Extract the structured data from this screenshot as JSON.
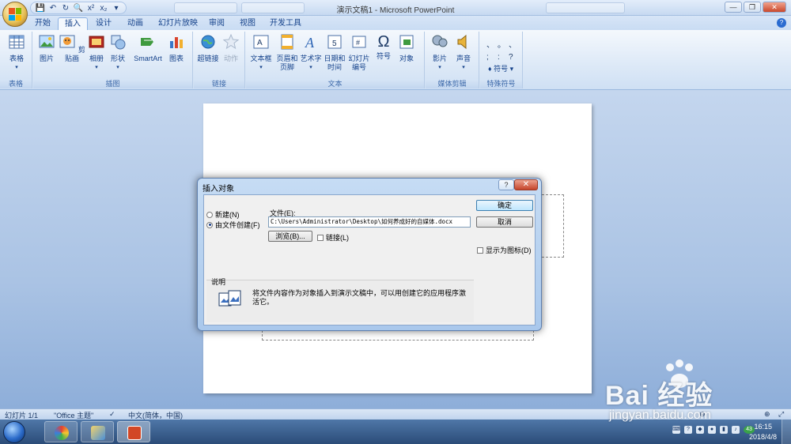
{
  "window": {
    "title": "演示文稿1 - Microsoft PowerPoint",
    "min_glyph": "—",
    "max_glyph": "❐",
    "close_glyph": "✕"
  },
  "qat": {
    "icons": [
      "save-icon",
      "undo-icon",
      "redo-icon",
      "print-preview-icon",
      "superscript-icon",
      "subscript-icon"
    ],
    "glyphs": [
      "💾",
      "↶",
      "↻",
      "🔍",
      "x²",
      "x₂"
    ],
    "more": "▾"
  },
  "tabs": [
    {
      "label": "开始"
    },
    {
      "label": "插入"
    },
    {
      "label": "设计"
    },
    {
      "label": "动画"
    },
    {
      "label": "幻灯片放映"
    },
    {
      "label": "审阅"
    },
    {
      "label": "视图"
    },
    {
      "label": "开发工具"
    }
  ],
  "active_tab": "插入",
  "ribbon": {
    "groups": {
      "table": "表格",
      "illustrations": "插图",
      "links": "链接",
      "text": "文本",
      "media": "媒体剪辑",
      "symbols": "特殊符号"
    },
    "buttons": {
      "table": "表格",
      "picture": "图片",
      "clipart": "剪贴画",
      "album": "相册",
      "shapes": "形状",
      "smartart": "SmartArt",
      "chart": "图表",
      "hyperlink": "超链接",
      "action": "动作",
      "textbox": "文本框",
      "header_footer": "页眉和页脚",
      "wordart": "艺术字",
      "datetime": "日期和时间",
      "slide_number": "幻灯片编号",
      "symbol": "符号",
      "object": "对象",
      "movie": "影片",
      "sound": "声音",
      "special_symbol": "符号"
    },
    "symbol_grid": [
      "、",
      "。",
      "、",
      ";",
      ":",
      "?"
    ],
    "omega": "Ω"
  },
  "dialog": {
    "title": "插入对象",
    "help": "?",
    "close": "✕",
    "radio_new": "新建(N)",
    "radio_from_file": "由文件创建(F)",
    "selected": "from_file",
    "file_label": "文件(E):",
    "file_value": "C:\\Users\\Administrator\\Desktop\\如何养成好的自媒体.docx",
    "browse": "浏览(B)...",
    "link": "链接(L)",
    "ok": "确定",
    "cancel": "取消",
    "display_as_icon": "显示为图标(D)",
    "description_label": "说明",
    "description": "将文件内容作为对象插入到演示文稿中，可以用创建它的应用程序激活它。"
  },
  "statusbar": {
    "slide": "幻灯片 1/1",
    "theme": "\"Office 主题\"",
    "language": "中文(简体，中国)",
    "zoom_minus": "⊖",
    "zoom_plus": "⊕"
  },
  "taskbar": {
    "time": "16:15",
    "date": "2018/4/8",
    "badge": "43"
  },
  "watermark": {
    "text": "Bai 经验",
    "url": "jingyan.baidu.com"
  }
}
